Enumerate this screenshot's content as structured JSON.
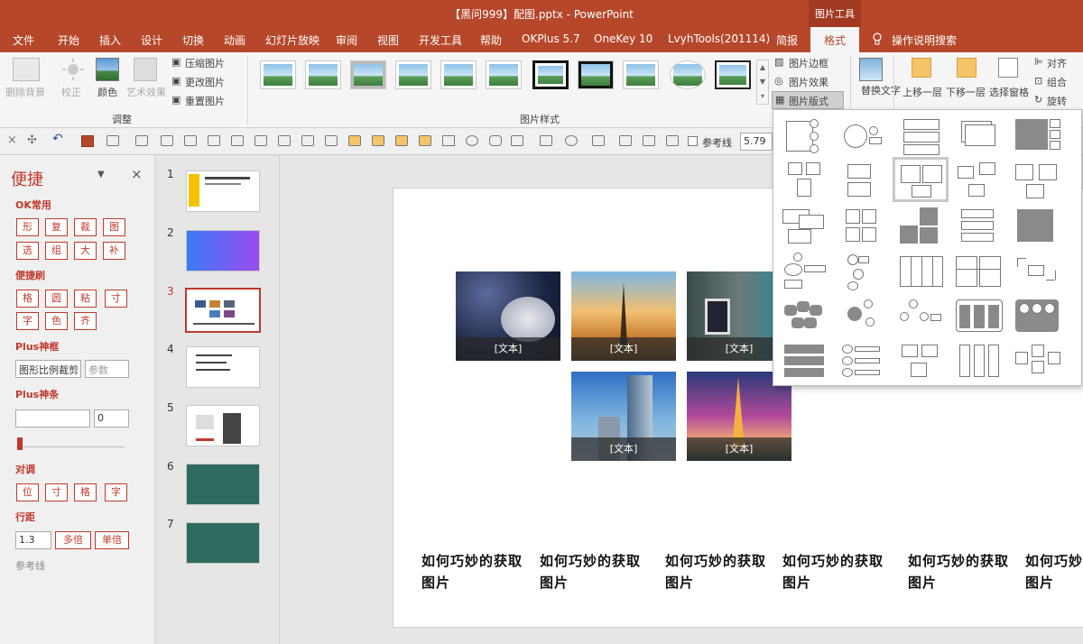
{
  "window": {
    "title": "【黑问999】配图.pptx  -  PowerPoint",
    "context_tab_group": "图片工具"
  },
  "tabs": [
    "文件",
    "开始",
    "插入",
    "设计",
    "切换",
    "动画",
    "幻灯片放映",
    "审阅",
    "视图",
    "开发工具",
    "帮助",
    "OKPlus 5.7",
    "OneKey 10",
    "LvyhTools(201114)",
    "简报",
    "格式"
  ],
  "tell_me": "操作说明搜索",
  "ribbon": {
    "adjust": {
      "remove_bg": "删除背景",
      "corrections": "校正",
      "color": "颜色",
      "artistic": "艺术效果",
      "compress": "压缩图片",
      "change": "更改图片",
      "reset": "重置图片",
      "group_label": "调整"
    },
    "styles": {
      "group_label": "图片样式",
      "border": "图片边框",
      "effects": "图片效果",
      "layout": "图片版式"
    },
    "alt_text": "替换文字",
    "arrange": {
      "bring_forward": "上移一层",
      "send_backward": "下移一层",
      "selection_pane": "选择窗格",
      "align": "对齐",
      "group": "组合",
      "rotate": "旋转"
    }
  },
  "qat": {
    "guide_label": "参考线",
    "size_value": "5.79"
  },
  "quick_panel": {
    "title": "便捷",
    "ok_common": {
      "label": "OK常用",
      "buttons": [
        "形",
        "复",
        "裁",
        "图",
        "选",
        "组",
        "大",
        "补"
      ]
    },
    "brush": {
      "label": "便捷刷",
      "buttons": [
        "格",
        "圆",
        "粘",
        "寸",
        "字",
        "色",
        "齐"
      ]
    },
    "frame": {
      "label": "Plus神框",
      "input": "图形比例裁剪",
      "param_placeholder": "参数"
    },
    "bar": {
      "label": "Plus神条",
      "value": "0"
    },
    "align": {
      "label": "对调",
      "buttons": [
        "位",
        "寸",
        "格",
        "字"
      ]
    },
    "spacing": {
      "label": "行距",
      "value": "1.3",
      "multi": "多倍",
      "single": "单倍"
    },
    "guide": "参考线"
  },
  "slides": [
    {
      "num": "1"
    },
    {
      "num": "2"
    },
    {
      "num": "3",
      "selected": true
    },
    {
      "num": "4"
    },
    {
      "num": "5"
    },
    {
      "num": "6"
    },
    {
      "num": "7"
    }
  ],
  "slide": {
    "captions": [
      "[文本]",
      "[文本]",
      "[文本]",
      "[文本]",
      "[文本]"
    ],
    "texts": [
      {
        "line1": "如何巧妙的获取",
        "line2": "图片"
      },
      {
        "line1": "如何巧妙的获取",
        "line2": "图片"
      },
      {
        "line1": "如何巧妙的获取",
        "line2": "图片"
      },
      {
        "line1": "如何巧妙的获取",
        "line2": "图片"
      },
      {
        "line1": "如何巧妙的获取",
        "line2": "图片"
      },
      {
        "line1": "如何巧妙的获取",
        "line2": "图片"
      }
    ]
  },
  "colors": {
    "accent": "#b7472a",
    "panel_red": "#c0392b",
    "selected_thumb": "#c0392b"
  }
}
